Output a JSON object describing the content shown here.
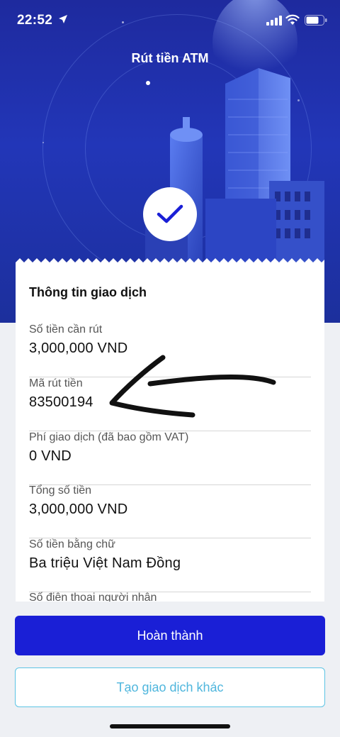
{
  "status_bar": {
    "time": "22:52",
    "icons": [
      "location-arrow-icon",
      "cellular-signal-icon",
      "wifi-icon",
      "battery-icon"
    ]
  },
  "header": {
    "title": "Rút tiền ATM",
    "success_icon": "checkmark-icon"
  },
  "card": {
    "title": "Thông tin giao dịch",
    "rows": [
      {
        "label": "Số tiền cần rút",
        "value": "3,000,000 VND"
      },
      {
        "label": "Mã rút tiền",
        "value": "83500194"
      },
      {
        "label": "Phí giao dịch (đã bao gồm VAT)",
        "value": "0 VND"
      },
      {
        "label": "Tổng số tiền",
        "value": "3,000,000 VND"
      },
      {
        "label": "Số tiền bằng chữ",
        "value": "Ba triệu Việt Nam Đồng"
      },
      {
        "label": "Số điện thoại người nhận",
        "value": ""
      }
    ]
  },
  "annotation": {
    "icon": "hand-drawn-arrow"
  },
  "buttons": {
    "primary_label": "Hoàn thành",
    "secondary_label": "Tạo giao dịch khác"
  },
  "colors": {
    "hero_blue": "#2236b8",
    "primary_button": "#1a1fd6",
    "secondary_border": "#5cc4e4",
    "secondary_text": "#4fb6dd"
  }
}
